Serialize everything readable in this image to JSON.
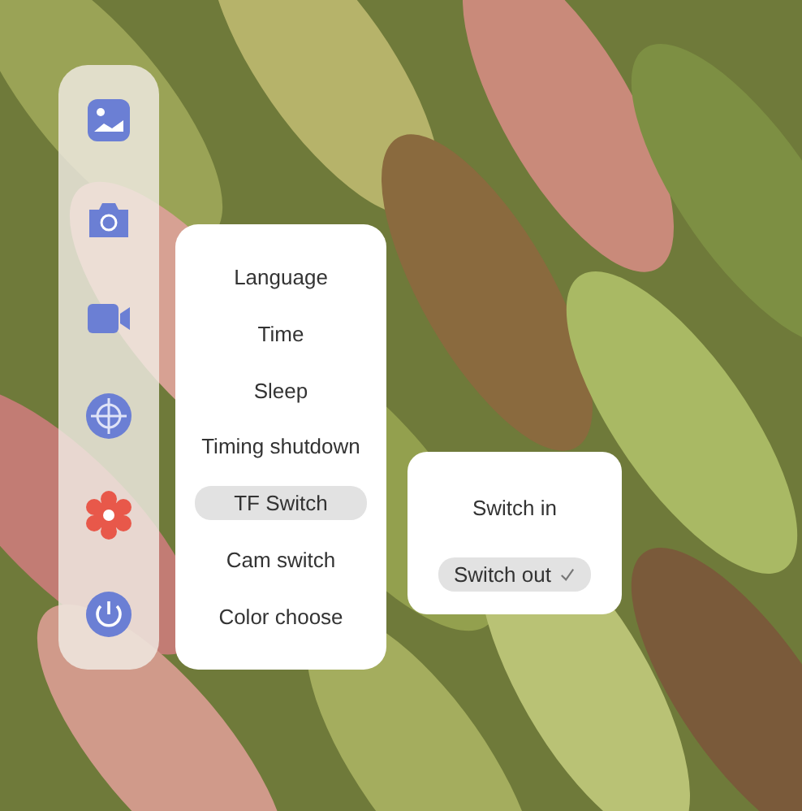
{
  "toolbar": [
    {
      "kind": "gallery",
      "selected": false
    },
    {
      "kind": "camera",
      "selected": false
    },
    {
      "kind": "video",
      "selected": false
    },
    {
      "kind": "target",
      "selected": false
    },
    {
      "kind": "settings",
      "selected": true
    },
    {
      "kind": "power",
      "selected": false
    }
  ],
  "menu": [
    {
      "label": "Language",
      "selected": false
    },
    {
      "label": "Time",
      "selected": false
    },
    {
      "label": "Sleep",
      "selected": false
    },
    {
      "label": "Timing shutdown",
      "selected": false
    },
    {
      "label": "TF  Switch",
      "selected": true
    },
    {
      "label": "Cam switch",
      "selected": false
    },
    {
      "label": "Color choose",
      "selected": false
    }
  ],
  "submenu": [
    {
      "label": "Switch in",
      "selected": false,
      "checked": false
    },
    {
      "label": "Switch out",
      "selected": true,
      "checked": true
    }
  ]
}
